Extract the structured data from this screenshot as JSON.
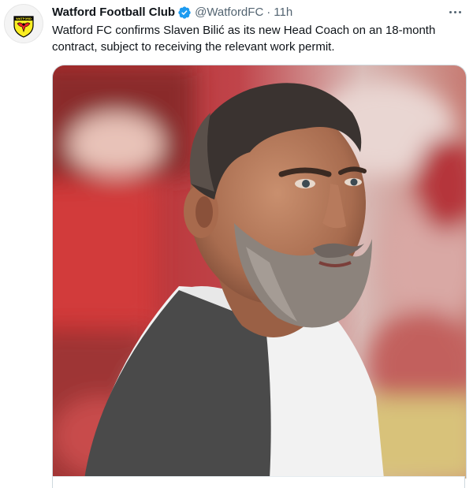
{
  "tweet": {
    "author": {
      "display_name": "Watford Football Club",
      "handle": "@WatfordFC",
      "verified": true,
      "avatar_text": "WATFORD"
    },
    "separator": "·",
    "time": "11h",
    "text": "Watford FC confirms Slaven Bilić as its new Head Coach on an 18-month contract, subject to receiving the relevant work permit.",
    "more_icon": "ellipsis-icon",
    "media": {
      "type": "photo",
      "alt": "Portrait photo"
    }
  },
  "colors": {
    "text_primary": "#0f1419",
    "text_secondary": "#536471",
    "verified_blue": "#1d9bf0",
    "border": "#cfd9de",
    "club_yellow": "#fbee23",
    "club_red": "#ed2127"
  }
}
